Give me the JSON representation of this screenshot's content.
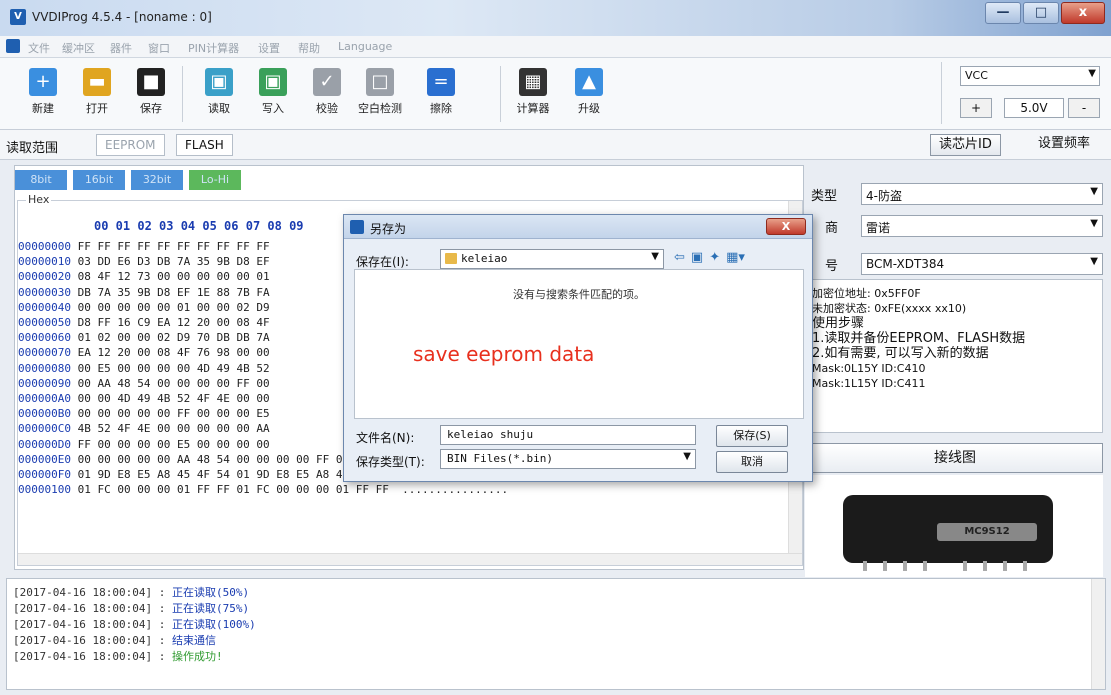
{
  "window": {
    "title": "VVDIProg 4.5.4 - [noname : 0]",
    "controls": [
      "—",
      "□",
      "x"
    ]
  },
  "menu": [
    "文件",
    "缓冲区",
    "器件",
    "窗口",
    "PIN计算器",
    "设置",
    "帮助",
    "Language"
  ],
  "toolbar": {
    "buttons": [
      {
        "label": "新建",
        "icon": "new-file-icon",
        "color": "#3a8fe0"
      },
      {
        "label": "打开",
        "icon": "open-folder-icon",
        "color": "#e0a520"
      },
      {
        "label": "保存",
        "icon": "save-icon",
        "color": "#222222"
      },
      {
        "label": "读取",
        "icon": "read-icon",
        "color": "#3aa0c8"
      },
      {
        "label": "写入",
        "icon": "write-icon",
        "color": "#3aa05a"
      },
      {
        "label": "校验",
        "icon": "verify-icon",
        "color": "#9aa0a8"
      },
      {
        "label": "空白检测",
        "icon": "blank-check-icon",
        "color": "#9aa0a8"
      },
      {
        "label": "擦除",
        "icon": "erase-icon",
        "color": "#2a6fd0"
      },
      {
        "label": "计算器",
        "icon": "calculator-icon",
        "color": "#333333"
      },
      {
        "label": "升级",
        "icon": "upgrade-icon",
        "color": "#3a8fe0"
      }
    ],
    "vcc": {
      "select": "VCC",
      "plus": "+",
      "value": "5.0V",
      "minus": "-"
    }
  },
  "range": {
    "label": "读取范围",
    "eeprom": "EEPROM",
    "flash": "FLASH",
    "read_chip_id": "读芯片ID",
    "set_freq": "设置频率"
  },
  "hex": {
    "width_buttons": [
      "8bit",
      "16bit",
      "32bit",
      "Lo-Hi"
    ],
    "legend": "Hex",
    "header": "00 01 02 03 04 05 06 07 08 09",
    "rows": [
      {
        "addr": "00000000",
        "bytes": " FF FF FF FF FF FF FF FF FF FF"
      },
      {
        "addr": "00000010",
        "bytes": " 03 DD E6 D3 DB 7A 35 9B D8 EF"
      },
      {
        "addr": "00000020",
        "bytes": " 08 4F 12 73 00 00 00 00 00 01"
      },
      {
        "addr": "00000030",
        "bytes": " DB 7A 35 9B D8 EF 1E 88 7B FA"
      },
      {
        "addr": "00000040",
        "bytes": " 00 00 00 00 00 01 00 00 02 D9"
      },
      {
        "addr": "00000050",
        "bytes": " D8 FF 16 C9 EA 12 20 00 08 4F"
      },
      {
        "addr": "00000060",
        "bytes": " 01 02 00 00 02 D9 70 DB DB 7A"
      },
      {
        "addr": "00000070",
        "bytes": " EA 12 20 00 08 4F 76 98 00 00"
      },
      {
        "addr": "00000080",
        "bytes": " 00 E5 00 00 00 00 4D 49 4B 52"
      },
      {
        "addr": "00000090",
        "bytes": " 00 AA 48 54 00 00 00 00 FF 00"
      },
      {
        "addr": "000000A0",
        "bytes": " 00 00 4D 49 4B 52 4F 4E 00 00"
      },
      {
        "addr": "000000B0",
        "bytes": " 00 00 00 00 00 FF 00 00 00 E5"
      },
      {
        "addr": "000000C0",
        "bytes": " 4B 52 4F 4E 00 00 00 00 00 AA"
      },
      {
        "addr": "000000D0",
        "bytes": " FF 00 00 00 00 E5 00 00 00 00"
      },
      {
        "addr": "000000E0",
        "bytes": " 00 00 00 00 00 AA 48 54 00 00 00 00 FF 00 00 00  ......HT........"
      },
      {
        "addr": "000000F0",
        "bytes": " 01 9D E8 E5 A8 45 4F 54 01 9D E8 E5 A8 45 4F 54  .....EOT.....EOT"
      },
      {
        "addr": "00000100",
        "bytes": " 01 FC 00 00 00 01 FF FF 01 FC 00 00 00 01 FF FF  ................"
      }
    ]
  },
  "right": {
    "type_label": "类型",
    "type_value": "4-防盗",
    "maker_label": "商",
    "maker_value": "雷诺",
    "model_label": "号",
    "model_value": "BCM-XDT384",
    "info": [
      "加密位地址: 0x5FF0F",
      "未加密状态: 0xFE(xxxx xx10)",
      "使用步骤",
      "1.读取并备份EEPROM、FLASH数据",
      "2.如有需要, 可以写入新的数据",
      "Mask:0L15Y ID:C410",
      "Mask:1L15Y ID:C411"
    ],
    "wiring_button": "接线图",
    "device_label": "MC9S12"
  },
  "log": [
    {
      "ts": "[2017-04-16 18:00:04] :",
      "msg": "正在读取(50%)",
      "ok": false
    },
    {
      "ts": "[2017-04-16 18:00:04] :",
      "msg": "正在读取(75%)",
      "ok": false
    },
    {
      "ts": "[2017-04-16 18:00:04] :",
      "msg": "正在读取(100%)",
      "ok": false
    },
    {
      "ts": "[2017-04-16 18:00:04] :",
      "msg": "结束通信",
      "ok": false
    },
    {
      "ts": "[2017-04-16 18:00:04] :",
      "msg": "操作成功!",
      "ok": true
    }
  ],
  "dialog": {
    "title": "另存为",
    "close": "X",
    "save_in_label": "保存在(I):",
    "save_in_value": "keleiao",
    "empty_text": "没有与搜索条件匹配的项。",
    "overlay_text": "save eeprom data",
    "filename_label": "文件名(N):",
    "filename_value": "keleiao shuju",
    "filetype_label": "保存类型(T):",
    "filetype_value": "BIN Files(*.bin)",
    "save_button": "保存(S)",
    "cancel_button": "取消"
  }
}
